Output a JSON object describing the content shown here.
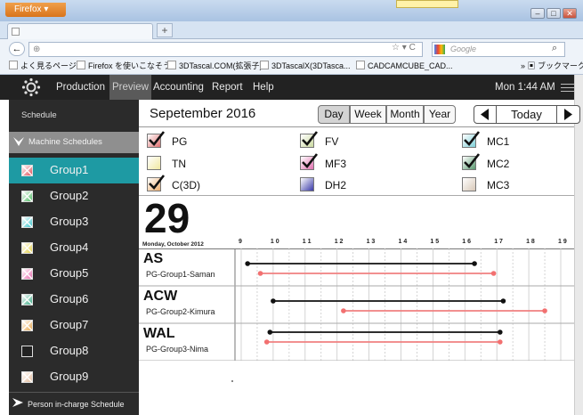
{
  "browser": {
    "firefox_button": "Firefox",
    "search_placeholder": "Google",
    "bookmarks": [
      "よく見るページ",
      "Firefox を使いこなそう",
      "3DTascal.COM(拡張子)",
      "3DTascalX(3DTasca...",
      "CADCAMCUBE_CAD..."
    ],
    "bookmarks_menu": "ブックマーク"
  },
  "app": {
    "menu": [
      "Production",
      "Preview",
      "Accounting",
      "Report",
      "Help"
    ],
    "clock": "Mon 1:44 AM"
  },
  "sidebar": {
    "schedule_label": "Schedule",
    "machine_schedules_label": "Machine Schedules",
    "groups": [
      {
        "label": "Group1",
        "color": "#e0505a",
        "selected": true
      },
      {
        "label": "Group2",
        "color": "#55c06a",
        "selected": false
      },
      {
        "label": "Group3",
        "color": "#3fc8cf",
        "selected": false
      },
      {
        "label": "Group4",
        "color": "#e6d34a",
        "selected": false
      },
      {
        "label": "Group5",
        "color": "#e86eb0",
        "selected": false
      },
      {
        "label": "Group6",
        "color": "#3fae88",
        "selected": false
      },
      {
        "label": "Group7",
        "color": "#e8a850",
        "selected": false
      },
      {
        "label": "Group8",
        "color": "#222222",
        "selected": false
      },
      {
        "label": "Group9",
        "color": "#e6bfa0",
        "selected": false
      }
    ],
    "person_schedule_label": "Person in-charge Schedule"
  },
  "header": {
    "date_title": "Sepetember 2016",
    "views": [
      "Day",
      "Week",
      "Month",
      "Year"
    ],
    "active_view": "Day",
    "today_label": "Today"
  },
  "filters": [
    {
      "label": "PG",
      "checked": true,
      "color": "#e07070"
    },
    {
      "label": "FV",
      "checked": true,
      "color": "#cbd9a0"
    },
    {
      "label": "MC1",
      "checked": true,
      "color": "#7fd0d8"
    },
    {
      "label": "TN",
      "checked": false,
      "color": "#f0e8a0"
    },
    {
      "label": "MF3",
      "checked": true,
      "color": "#e070b0"
    },
    {
      "label": "MC2",
      "checked": true,
      "color": "#5a9a70"
    },
    {
      "label": "C(3D)",
      "checked": true,
      "color": "#f0b070"
    },
    {
      "label": "DH2",
      "checked": false,
      "color": "#3a3aa8"
    },
    {
      "label": "MC3",
      "checked": false,
      "color": "#d8c8b8"
    }
  ],
  "day": {
    "number": "29",
    "subtitle": "Monday, October 2012",
    "hours": [
      "9",
      "1 0",
      "1 1",
      "1 2",
      "1 3",
      "1 4",
      "1 5",
      "1 6",
      "1 7",
      "1 8",
      "1 9"
    ]
  },
  "rows": [
    {
      "code": "AS",
      "sub": "PG-Group1-Saman",
      "black": [
        9.2,
        16.3
      ],
      "red": [
        9.6,
        16.9
      ]
    },
    {
      "code": "ACW",
      "sub": "PG-Group2-Kimura",
      "black": [
        10.0,
        17.2
      ],
      "red": [
        12.2,
        18.5
      ]
    },
    {
      "code": "WAL",
      "sub": "PG-Group3-Nima",
      "black": [
        9.9,
        17.1
      ],
      "red": [
        9.8,
        17.1
      ]
    }
  ]
}
